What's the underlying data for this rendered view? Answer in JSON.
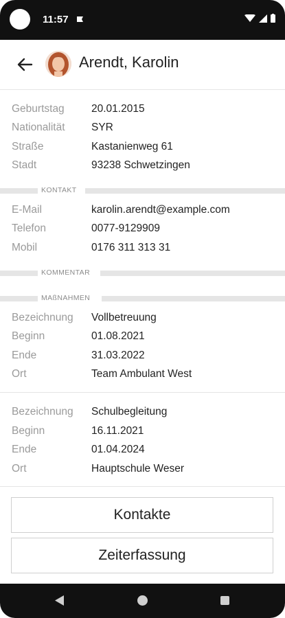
{
  "status_bar": {
    "time": "11:57"
  },
  "header": {
    "title": "Arendt, Karolin"
  },
  "personal": [
    {
      "label": "Geburtstag",
      "value": "20.01.2015"
    },
    {
      "label": "Nationalität",
      "value": "SYR"
    },
    {
      "label": "Straße",
      "value": "Kastanienweg 61"
    },
    {
      "label": "Stadt",
      "value": "93238 Schwetzingen"
    }
  ],
  "sections": {
    "kontakt": "KONTAKT",
    "kommentar": "KOMMENTAR",
    "massnahmen": "MAßNAHMEN"
  },
  "contact": [
    {
      "label": "E-Mail",
      "value": "karolin.arendt@example.com"
    },
    {
      "label": "Telefon",
      "value": "0077-9129909"
    },
    {
      "label": "Mobil",
      "value": "0176 311 313 31"
    }
  ],
  "measures": [
    [
      {
        "label": "Bezeichnung",
        "value": "Vollbetreuung"
      },
      {
        "label": "Beginn",
        "value": "01.08.2021"
      },
      {
        "label": "Ende",
        "value": "31.03.2022"
      },
      {
        "label": "Ort",
        "value": "Team Ambulant West"
      }
    ],
    [
      {
        "label": "Bezeichnung",
        "value": "Schulbegleitung"
      },
      {
        "label": "Beginn",
        "value": "16.11.2021"
      },
      {
        "label": "Ende",
        "value": "01.04.2024"
      },
      {
        "label": "Ort",
        "value": "Hauptschule Weser"
      }
    ]
  ],
  "buttons": {
    "contacts": "Kontakte",
    "time_tracking": "Zeiterfassung"
  }
}
